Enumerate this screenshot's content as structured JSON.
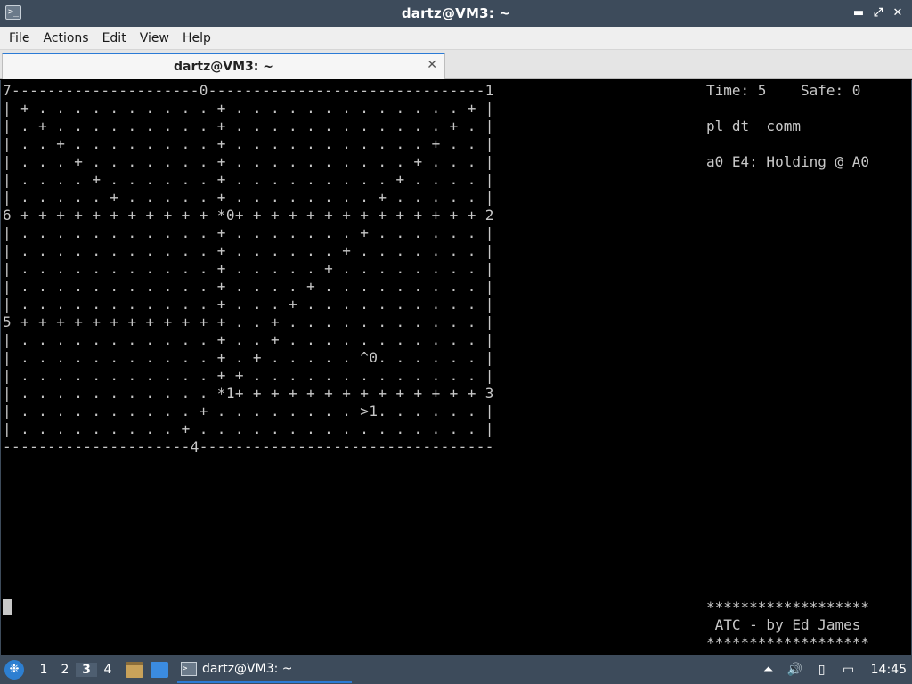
{
  "window": {
    "title": "dartz@VM3: ~",
    "app_icon_glyph": ">_",
    "controls": {
      "minimize": "▬",
      "maximize": "⤢",
      "close": "✕"
    }
  },
  "menubar": {
    "items": [
      "File",
      "Actions",
      "Edit",
      "View",
      "Help"
    ]
  },
  "tabs": [
    {
      "label": "dartz@VM3: ~",
      "close": "✕"
    }
  ],
  "terminal": {
    "radar_lines": [
      "7---------------------0-------------------------------1",
      "| + . . . . . . . . . . + . . . . . . . . . . . . . + |",
      "| . + . . . . . . . . . + . . . . . . . . . . . . + . |",
      "| . . + . . . . . . . . + . . . . . . . . . . . + . . |",
      "| . . . + . . . . . . . + . . . . . . . . . . + . . . |",
      "| . . . . + . . . . . . + . . . . . . . . . + . . . . |",
      "| . . . . . + . . . . . + . . . . . . . . + . . . . . |",
      "6 + + + + + + + + + + + *0+ + + + + + + + + + + + + + 2",
      "| . . . . . . . . . . . + . . . . . . . + . . . . . . |",
      "| . . . . . . . . . . . + . . . . . . + . . . . . . . |",
      "| . . . . . . . . . . . + . . . . . + . . . . . . . . |",
      "| . . . . . . . . . . . + . . . . + . . . . . . . . . |",
      "| . . . . . . . . . . . + . . . + . . . . . . . . . . |",
      "5 + + + + + + + + + + + + . . + . . . . . . . . . . . |",
      "| . . . . . . . . . . . + . . + . . . . . . . . . . . |",
      "| . . . . . . . . . . . + . + . . . . . ^0. . . . . . |",
      "| . . . . . . . . . . . + + . . . . . . . . . . . . . |",
      "| . . . . . . . . . . . *1+ + + + + + + + + + + + + + 3",
      "| . . . . . . . . . . + . . . . . . . . >1. . . . . . |",
      "| . . . . . . . . . + . . . . . . . . . . . . . . . . |",
      "---------------------4---------------------------------"
    ],
    "info_lines": [
      "Time: 5    Safe: 0",
      "",
      "pl dt  comm",
      "",
      "a0 E4: Holding @ A0"
    ],
    "credits_lines": [
      "*******************",
      " ATC - by Ed James",
      "*******************"
    ]
  },
  "taskbar": {
    "start_glyph": "❉",
    "workspaces": [
      "1",
      "2",
      "3",
      "4"
    ],
    "active_workspace": "3",
    "task_label": "dartz@VM3: ~",
    "task_icon_glyph": ">_",
    "tray_icons": [
      "upload-icon",
      "volume-icon",
      "clipboard-icon",
      "network-icon"
    ],
    "tray_glyphs": [
      "⏶",
      "🔊",
      "▯",
      "▭"
    ],
    "clock": "14:45"
  }
}
